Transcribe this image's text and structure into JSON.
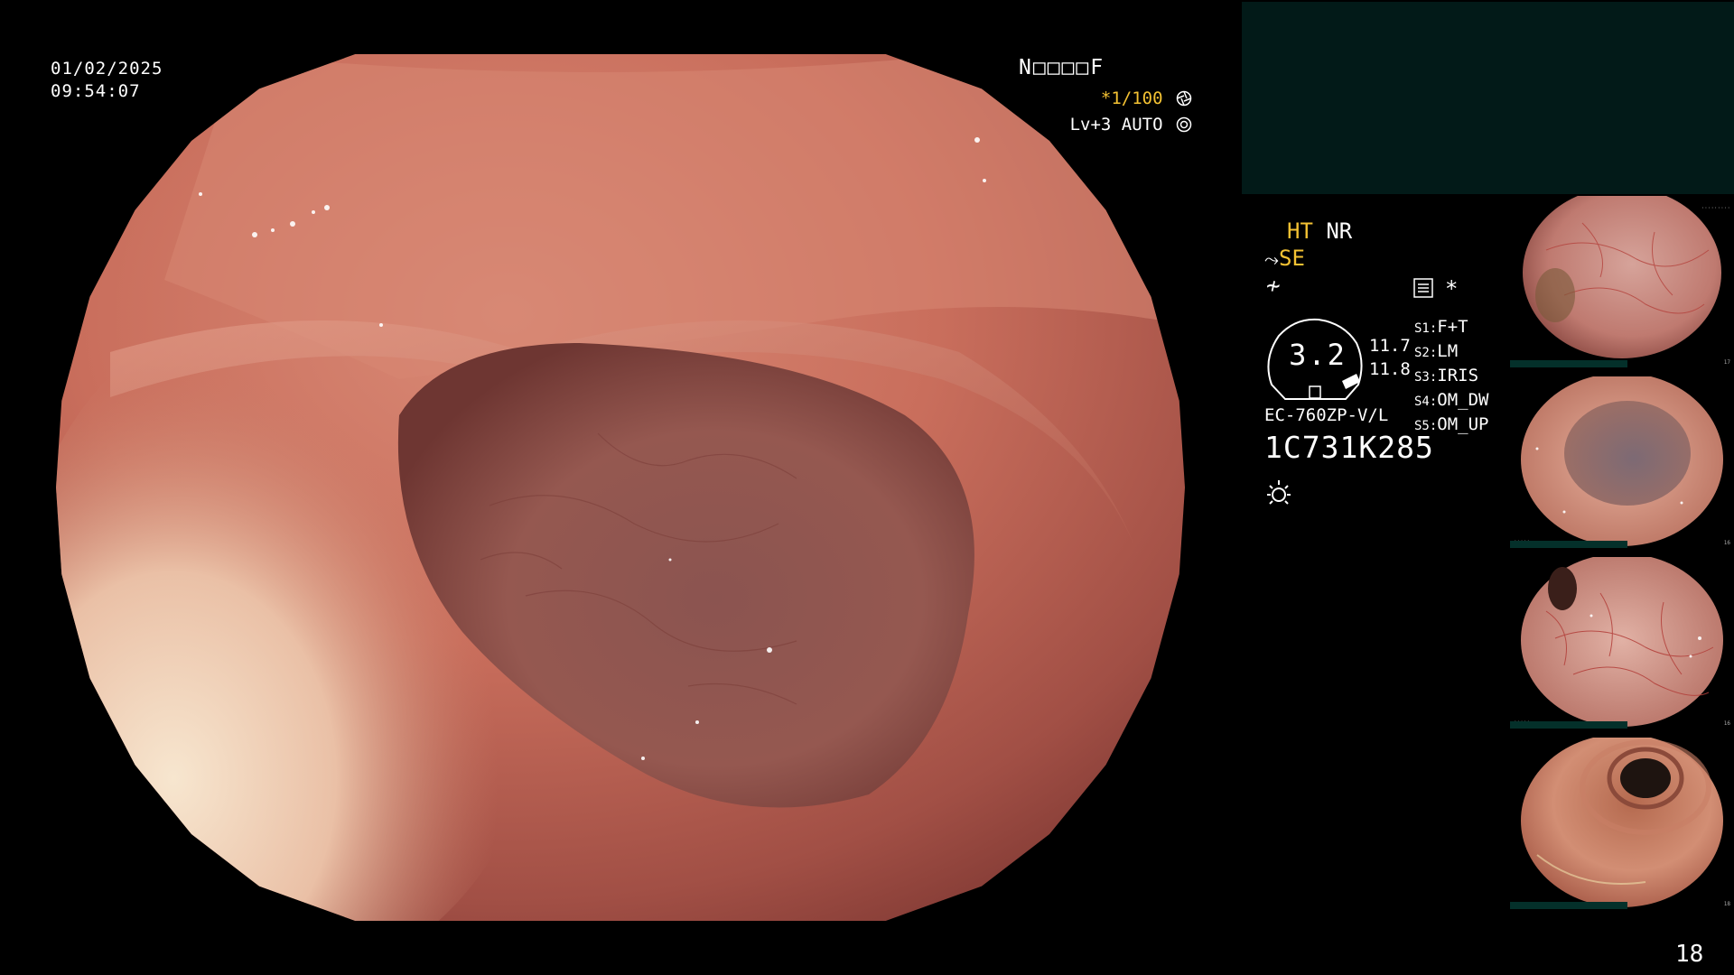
{
  "overlay": {
    "date": "01/02/2025",
    "time": "09:54:07",
    "patient_id": "N□□□□F",
    "shutter": "*1/100",
    "level": "Lv+3 AUTO"
  },
  "panel": {
    "ht_label": "HT",
    "nr_label": "NR",
    "se_label": "SE",
    "star": "*",
    "gauge_value": "3.2",
    "readings": [
      "11.7",
      "11.8"
    ],
    "scope_model": "EC-760ZP-V/L",
    "serial": "1C731K285",
    "switches": [
      {
        "key": "S1:",
        "value": "F+T"
      },
      {
        "key": "S2:",
        "value": "LM"
      },
      {
        "key": "S3:",
        "value": "IRIS"
      },
      {
        "key": "S4:",
        "value": "OM_DW"
      },
      {
        "key": "S5:",
        "value": "OM_UP"
      }
    ]
  },
  "thumbnails": [
    {
      "label": "thumbnail-1",
      "number": "17"
    },
    {
      "label": "thumbnail-2",
      "number": "16"
    },
    {
      "label": "thumbnail-3",
      "number": "16"
    },
    {
      "label": "thumbnail-4",
      "number": "18"
    }
  ],
  "page_number": "18",
  "colors": {
    "accent_yellow": "#f4c233",
    "panel_teal": "#021a18",
    "mucosa": "#c9705f"
  },
  "icons": {
    "shutter": "aperture-icon",
    "level": "iris-icon",
    "menu": "menu-icon",
    "light": "light-icon"
  }
}
